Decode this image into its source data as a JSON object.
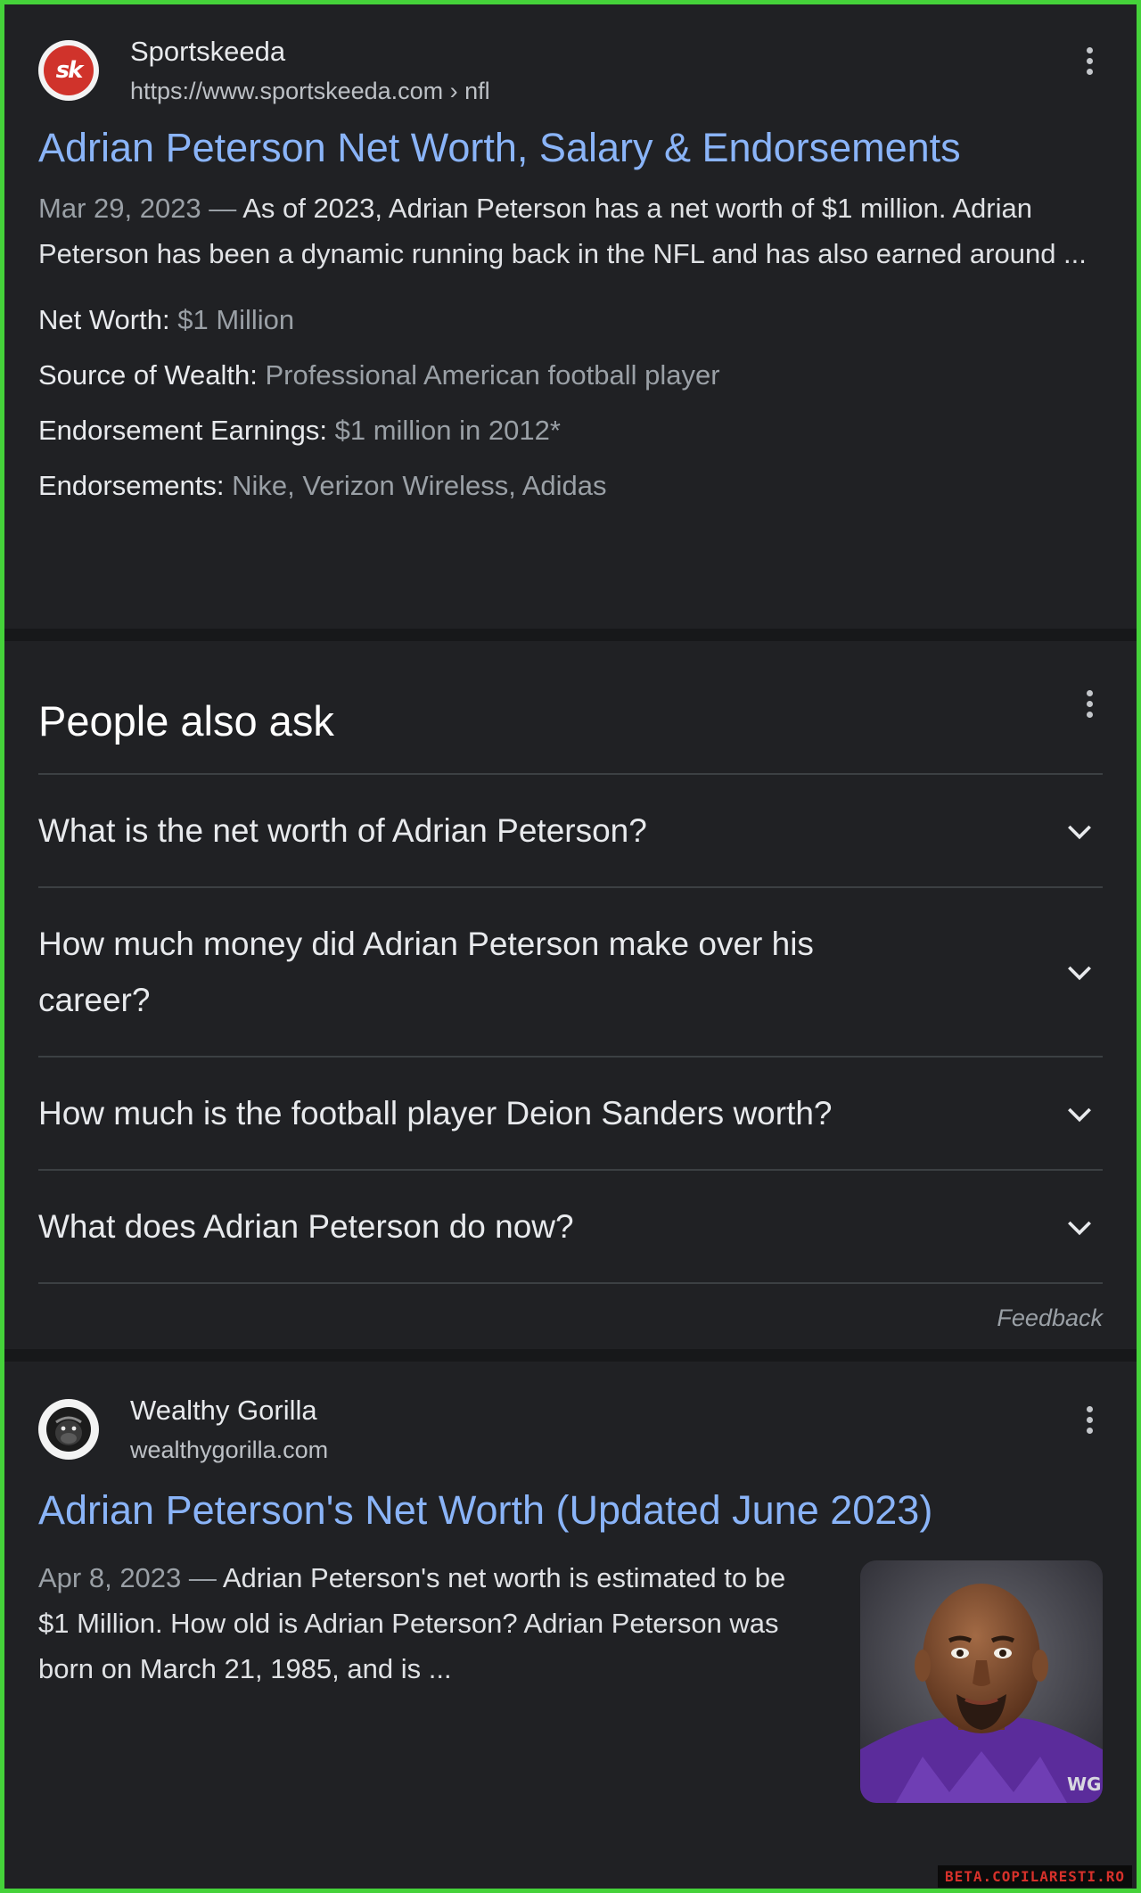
{
  "result1": {
    "favicon_text": "sk",
    "site_name": "Sportskeeda",
    "site_url": "https://www.sportskeeda.com › nfl",
    "title": "Adrian Peterson Net Worth, Salary & Endorsements",
    "date": "Mar 29, 2023",
    "dash": " — ",
    "snippet": "As of 2023, Adrian Peterson has a net worth of $1 million. Adrian Peterson has been a dynamic running back in the NFL and has also earned around ...",
    "facts": [
      {
        "key": "Net Worth:",
        "value": "$1 Million"
      },
      {
        "key": "Source of Wealth:",
        "value": "Professional American football player"
      },
      {
        "key": "Endorsement Earnings:",
        "value": "$1 million in 2012*"
      },
      {
        "key": "Endorsements:",
        "value": "Nike, Verizon Wireless, Adidas"
      }
    ],
    "menu_icon": "more-vert-icon"
  },
  "people_also_ask": {
    "title": "People also ask",
    "questions": [
      "What is the net worth of Adrian Peterson?",
      "How much money did Adrian Peterson make over his career?",
      "How much is the football player Deion Sanders worth?",
      "What does Adrian Peterson do now?"
    ],
    "feedback": "Feedback",
    "expand_icon": "chevron-down-icon"
  },
  "result2": {
    "site_name": "Wealthy Gorilla",
    "site_url": "wealthygorilla.com",
    "title": "Adrian Peterson's Net Worth (Updated June 2023)",
    "date": "Apr 8, 2023",
    "dash": " — ",
    "snippet": "Adrian Peterson's net worth is estimated to be $1 Million. How old is Adrian Peterson? Adrian Peterson was born on March 21, 1985, and is ...",
    "thumbnail_label": "WG",
    "menu_icon": "more-vert-icon"
  },
  "watermark": "BETA.COPILARESTI.RO",
  "colors": {
    "background": "#202124",
    "link": "#8ab4f8",
    "border": "#45d23a"
  }
}
